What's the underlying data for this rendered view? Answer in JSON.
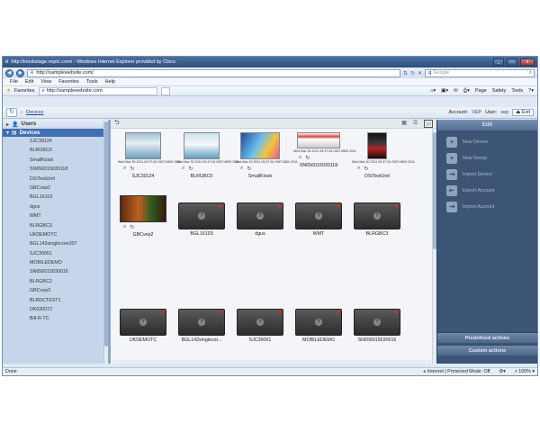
{
  "browser": {
    "title": "http://kioskstage.veptc.com/ - Windows Internet Explorer provided by Cisco",
    "address": "http://samplewebsite.com/",
    "search_placeholder": "Google",
    "menu": [
      "File",
      "Edit",
      "View",
      "Favorites",
      "Tools",
      "Help"
    ],
    "favorites_label": "Favorites",
    "tab_title": "http://samplewebsite.com",
    "toolbar": [
      "Page",
      "Safety",
      "Tools"
    ]
  },
  "app": {
    "breadcrumb": "Devices",
    "account_label": "Account:",
    "account_value": "VEP",
    "user_label": "User:",
    "user_value": "vep",
    "exit_label": "Exit"
  },
  "sidebar": {
    "users_label": "Users",
    "devices_label": "Devices",
    "items": [
      "SJC30124",
      "BLRGBC0",
      "SmallKiosk",
      "SN656015030118",
      "DSITestUnit",
      "GBCvep2",
      "BGL16103",
      "dgus",
      "WMT",
      "BLRGBC3",
      "UKDEMOTC",
      "BGL142singlecore207",
      "SJC30061",
      "MOBILEDEMO",
      "SN656015030016",
      "BLRGBC2",
      "GBCvep3",
      "BLRDCTEST1",
      "DK030072",
      "Bill-R-TC"
    ]
  },
  "tiles": [
    {
      "name": "SJC30124",
      "stamp": "Wed Mar 30 2011 09:37:26 GMT-0800 2011"
    },
    {
      "name": "BLRGBC0",
      "stamp": "Wed Mar 30 2011 09:37:26 GMT-0800 2011"
    },
    {
      "name": "SmallKiosk",
      "stamp": "Wed Mar 30 2011 09:37:26 GMT-0800 2011"
    },
    {
      "name": "SN656015030118",
      "stamp": "Wed Mar 30 2011 09:37:26 GMT-0800 2011"
    },
    {
      "name": "DSITestUnit",
      "stamp": "Wed Mar 30 2011 09:37:26 GMT-0800 2011"
    },
    {
      "name": "GBCvep2",
      "stamp": ""
    },
    {
      "name": "BGL16103",
      "stamp": ""
    },
    {
      "name": "dgus",
      "stamp": ""
    },
    {
      "name": "WMT",
      "stamp": ""
    },
    {
      "name": "BLRGBC3",
      "stamp": ""
    },
    {
      "name": "UKDEMOTC",
      "stamp": ""
    },
    {
      "name": "BGL142singlecor...",
      "stamp": ""
    },
    {
      "name": "SJC30061",
      "stamp": ""
    },
    {
      "name": "MOBILEDEMO",
      "stamp": ""
    },
    {
      "name": "SN656015030016",
      "stamp": ""
    }
  ],
  "panel": {
    "header": "Edit",
    "actions": [
      "New Device",
      "New Group",
      "Import Device",
      "Export Account",
      "Import Account"
    ],
    "predefined_label": "Predefined actions",
    "custom_label": "Custom actions"
  },
  "status": {
    "left": "Done",
    "zone": "Internet | Protected Mode: Off",
    "zoom": "100%"
  },
  "colors": {
    "sidebar_bg": "#c6d5ea",
    "selected": "#3f6fb5",
    "panel_bg": "#3d5575"
  }
}
